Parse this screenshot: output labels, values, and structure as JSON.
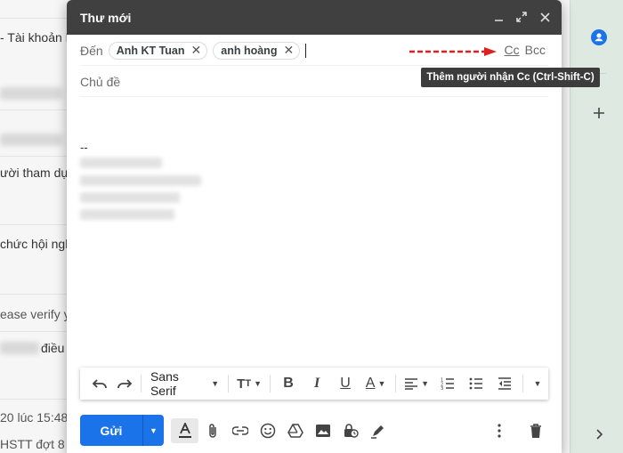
{
  "background": {
    "snippets": [
      "- Tài khoản N",
      "ười tham dự t",
      "chức hội ngh",
      "ease verify y",
      "điều",
      "20 lúc 15:48",
      "HSTT đợt 8 c"
    ]
  },
  "compose": {
    "title": "Thư mới",
    "to_label": "Đến",
    "recipients": [
      "Anh KT Tuan",
      "anh hoàng"
    ],
    "cc_label": "Cc",
    "bcc_label": "Bcc",
    "tooltip": "Thêm người nhận Cc (Ctrl-Shift-C)",
    "subject_placeholder": "Chủ đề",
    "signature_dash": "--",
    "font": "Sans Serif",
    "send_label": "Gửi"
  },
  "colors": {
    "header_bg": "#404040",
    "send_button": "#1a73e8",
    "arrow": "#e02020",
    "side_panel": "#dde9e1",
    "contacts_icon": "#1a73e8"
  }
}
